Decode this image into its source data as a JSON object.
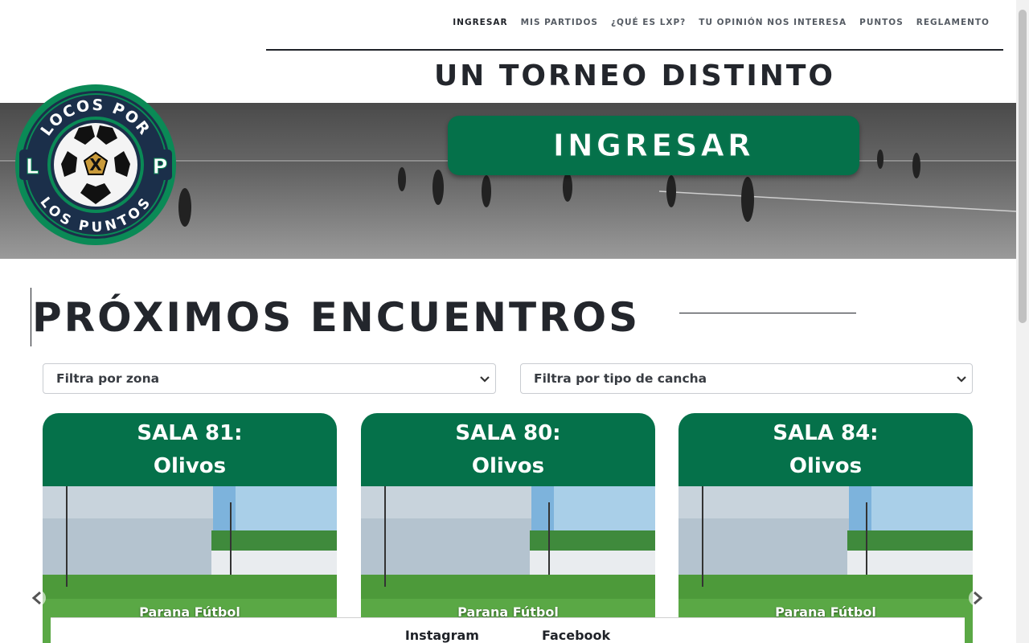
{
  "nav": {
    "items": [
      {
        "label": "INGRESAR",
        "active": true
      },
      {
        "label": "MIS PARTIDOS",
        "active": false
      },
      {
        "label": "¿QUÉ ES LXP?",
        "active": false
      },
      {
        "label": "TU OPINIÓN NOS INTERESA",
        "active": false
      },
      {
        "label": "PUNTOS",
        "active": false
      },
      {
        "label": "REGLAMENTO",
        "active": false
      }
    ]
  },
  "hero": {
    "tagline": "UN TORNEO DISTINTO",
    "cta_label": "INGRESAR"
  },
  "logo": {
    "top_text": "LOCOS POR",
    "bottom_text": "LOS PUNTOS",
    "left_letter": "L",
    "center_letter": "X",
    "right_letter": "P"
  },
  "section": {
    "title": "PRÓXIMOS ENCUENTROS"
  },
  "filters": {
    "zone_label": "Filtra por zona",
    "type_label": "Filtra por tipo de cancha"
  },
  "cards": [
    {
      "room": "SALA 81:",
      "location": "Olivos",
      "venue": "Parana Fútbol"
    },
    {
      "room": "SALA 80:",
      "location": "Olivos",
      "venue": "Parana Fútbol"
    },
    {
      "room": "SALA 84:",
      "location": "Olivos",
      "venue": "Parana Fútbol"
    }
  ],
  "footer": {
    "instagram": "Instagram",
    "facebook": "Facebook"
  },
  "colors": {
    "brand_green": "#05714a",
    "text_dark": "#23262c"
  },
  "icons": {
    "prev": "chevron-left-icon",
    "next": "chevron-right-icon",
    "select": "chevron-down-icon"
  }
}
